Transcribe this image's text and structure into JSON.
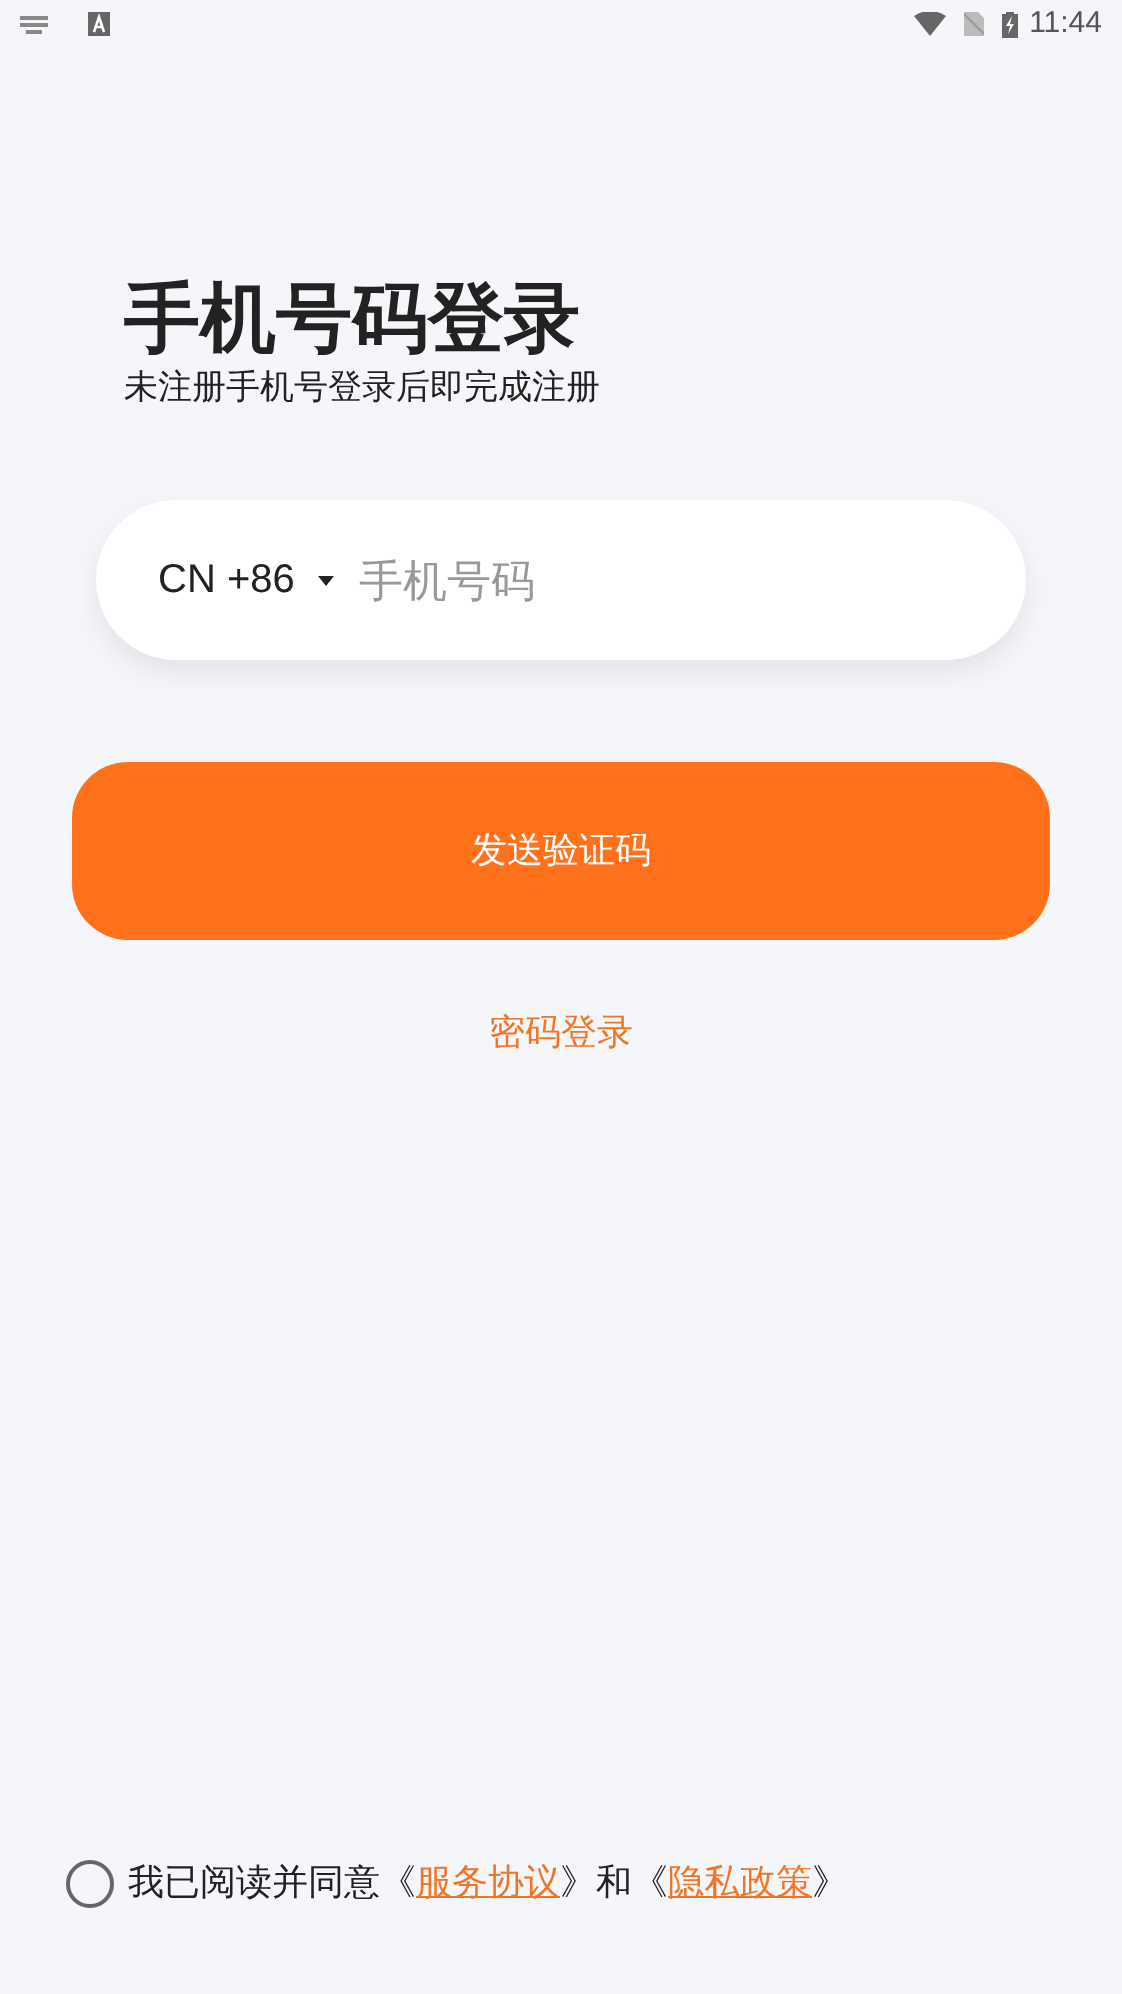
{
  "status_bar": {
    "time": "11:44"
  },
  "title": "手机号码登录",
  "subtitle": "未注册手机号登录后即完成注册",
  "phone": {
    "country_code": "CN +86",
    "placeholder": "手机号码"
  },
  "send_button": "发送验证码",
  "password_login": "密码登录",
  "agreement": {
    "checked": false,
    "parts": [
      {
        "kind": "text",
        "text": "我已阅读并同意《"
      },
      {
        "kind": "link",
        "text": "服务协议"
      },
      {
        "kind": "text",
        "text": "》和《"
      },
      {
        "kind": "link",
        "text": "隐私政策"
      },
      {
        "kind": "text",
        "text": "》"
      }
    ]
  }
}
